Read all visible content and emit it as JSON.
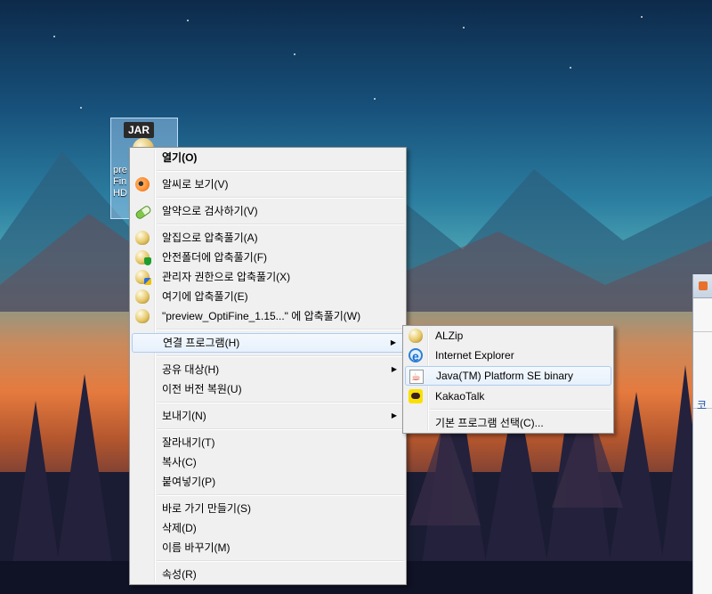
{
  "desktop_icon": {
    "badge": "JAR",
    "label": "pre\nFin\nHD"
  },
  "context_menu": {
    "items": [
      {
        "label": "열기(O)",
        "icon": "none",
        "bold": true
      },
      {
        "sep": true
      },
      {
        "label": "알씨로 보기(V)",
        "icon": "alsee-icon"
      },
      {
        "sep": true
      },
      {
        "label": "알약으로 검사하기(V)",
        "icon": "alyac-pill-icon"
      },
      {
        "sep": true
      },
      {
        "label": "알집으로 압축풀기(A)",
        "icon": "alzip-icon"
      },
      {
        "label": "안전폴더에 압축풀기(F)",
        "icon": "alzip-shield-icon"
      },
      {
        "label": "관리자 권한으로 압축풀기(X)",
        "icon": "alzip-admin-icon"
      },
      {
        "label": "여기에 압축풀기(E)",
        "icon": "alzip-icon"
      },
      {
        "label": "\"preview_OptiFine_1.15...\" 에 압축풀기(W)",
        "icon": "alzip-icon"
      },
      {
        "sep": true
      },
      {
        "label": "연결 프로그램(H)",
        "icon": "none",
        "submenu": true,
        "highlighted": true
      },
      {
        "sep": true
      },
      {
        "label": "공유 대상(H)",
        "icon": "none",
        "submenu": true
      },
      {
        "label": "이전 버전 복원(U)",
        "icon": "none"
      },
      {
        "sep": true
      },
      {
        "label": "보내기(N)",
        "icon": "none",
        "submenu": true
      },
      {
        "sep": true
      },
      {
        "label": "잘라내기(T)",
        "icon": "none"
      },
      {
        "label": "복사(C)",
        "icon": "none"
      },
      {
        "label": "붙여넣기(P)",
        "icon": "none"
      },
      {
        "sep": true
      },
      {
        "label": "바로 가기 만들기(S)",
        "icon": "none"
      },
      {
        "label": "삭제(D)",
        "icon": "none"
      },
      {
        "label": "이름 바꾸기(M)",
        "icon": "none"
      },
      {
        "sep": true
      },
      {
        "label": "속성(R)",
        "icon": "none"
      }
    ]
  },
  "open_with_submenu": {
    "items": [
      {
        "label": "ALZip",
        "icon": "alzip-icon"
      },
      {
        "label": "Internet Explorer",
        "icon": "internet-explorer-icon"
      },
      {
        "label": "Java(TM) Platform SE binary",
        "icon": "java-icon",
        "highlighted": true
      },
      {
        "label": "KakaoTalk",
        "icon": "kakaotalk-icon"
      },
      {
        "sep": true
      },
      {
        "label": "기본 프로그램 선택(C)...",
        "icon": "none"
      }
    ]
  },
  "background_window": {
    "partial_text": "코"
  }
}
